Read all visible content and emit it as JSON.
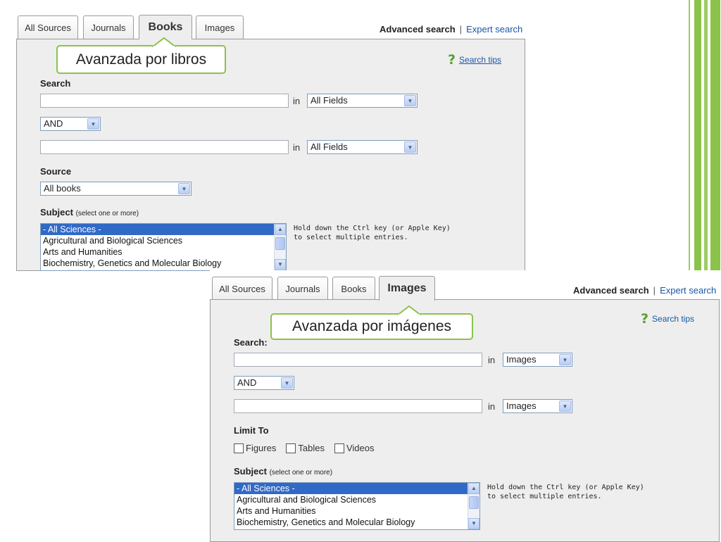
{
  "tabs": {
    "all_sources": "All Sources",
    "journals": "Journals",
    "books": "Books",
    "images": "Images"
  },
  "advanced_search": "Advanced search",
  "separator": "|",
  "expert_search": "Expert search",
  "search_tips": "Search tips",
  "in_label": "in",
  "books_panel": {
    "callout": "Avanzada por libros",
    "search_label": "Search",
    "field_select": "All Fields",
    "bool_select": "AND",
    "source_label": "Source",
    "source_select": "All books",
    "subject_label": "Subject",
    "subject_hint": "(select one or more)",
    "subjects": [
      "- All Sciences -",
      "Agricultural and Biological Sciences",
      "Arts and Humanities",
      "Biochemistry, Genetics and Molecular Biology"
    ],
    "ctrl_hint_1": "Hold down the Ctrl key (or Apple Key)",
    "ctrl_hint_2": "to select multiple entries."
  },
  "images_panel": {
    "callout": "Avanzada por imágenes",
    "search_label": "Search:",
    "field_select": "Images",
    "bool_select": "AND",
    "limit_label": "Limit To",
    "limits": [
      "Figures",
      "Tables",
      "Videos"
    ],
    "subject_label": "Subject",
    "subject_hint": "(select one or more)",
    "subjects": [
      "- All Sciences -",
      "Agricultural and Biological Sciences",
      "Arts and Humanities",
      "Biochemistry, Genetics and Molecular Biology"
    ],
    "ctrl_hint_1": "Hold down the Ctrl key (or Apple Key)",
    "ctrl_hint_2": "to select multiple entries."
  },
  "colors": {
    "accent_green": "#8bc34a",
    "link_blue": "#1a56a8",
    "selection_blue": "#3169c6"
  }
}
